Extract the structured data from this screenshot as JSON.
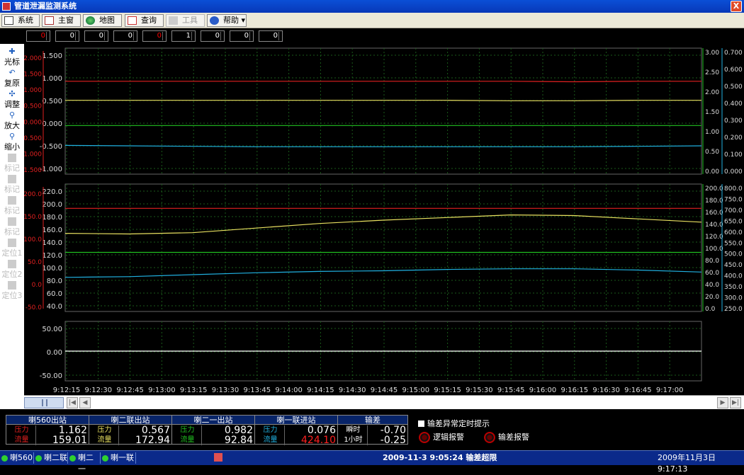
{
  "window": {
    "title": "管道泄漏监测系统",
    "close_label": "X"
  },
  "menu": {
    "system": "系统",
    "main": "主窗",
    "map": "地图",
    "query": "查询",
    "tools": "工具",
    "help": "帮助"
  },
  "spinners": [
    "0",
    "0",
    "0",
    "0",
    "0",
    "1",
    "0",
    "0",
    "0"
  ],
  "left_toolbar": [
    {
      "label": "光标",
      "icon": "plus-icon",
      "enabled": true
    },
    {
      "label": "复原",
      "icon": "undo-icon",
      "enabled": true
    },
    {
      "label": "调整",
      "icon": "adjust-icon",
      "enabled": true
    },
    {
      "label": "放大",
      "icon": "zoom-in-icon",
      "enabled": true
    },
    {
      "label": "缩小",
      "icon": "zoom-out-icon",
      "enabled": true
    },
    {
      "label": "标记",
      "icon": "mark-icon",
      "enabled": false
    },
    {
      "label": "标记",
      "icon": "mark-icon",
      "enabled": false
    },
    {
      "label": "标记",
      "icon": "mark-icon",
      "enabled": false
    },
    {
      "label": "标记",
      "icon": "mark-icon",
      "enabled": false
    },
    {
      "label": "定位1",
      "icon": "locate-icon",
      "enabled": false
    },
    {
      "label": "定位2",
      "icon": "locate-icon",
      "enabled": false
    },
    {
      "label": "定位3",
      "icon": "locate-icon",
      "enabled": false
    }
  ],
  "colors": {
    "red": "#e02020",
    "yellow": "#e8e060",
    "green": "#20c020",
    "cyan": "#20b0e0",
    "white": "#ffffff"
  },
  "chart_data": [
    {
      "type": "line",
      "left_outer_ticks": [
        "2.000",
        "1.500",
        "1.000",
        "0.500",
        "0.000",
        "-0.500",
        "-1.000",
        "-1.500"
      ],
      "left_inner_ticks": [
        "1.500",
        "1.000",
        "0.500",
        "0.000",
        "-0.500",
        "-1.000"
      ],
      "right_inner_ticks": [
        "3.00",
        "2.50",
        "2.00",
        "1.50",
        "1.00",
        "0.50",
        "0.00"
      ],
      "right_outer_ticks": [
        "0.700",
        "0.600",
        "0.500",
        "0.400",
        "0.300",
        "0.200",
        "0.100",
        "0.000"
      ],
      "series": [
        {
          "color": "red",
          "values": [
            1.0,
            1.0,
            1.0,
            1.0,
            1.0,
            1.0,
            1.0,
            1.0,
            0.99,
            1.0,
            1.0
          ]
        },
        {
          "color": "yellow",
          "values": [
            0.57,
            0.57,
            0.57,
            0.57,
            0.57,
            0.57,
            0.57,
            0.56,
            0.56,
            0.57,
            0.57
          ]
        },
        {
          "color": "green",
          "values": [
            0.0,
            0.0,
            0.0,
            0.0,
            0.0,
            0.0,
            0.0,
            0.0,
            0.0,
            0.0,
            0.0
          ]
        },
        {
          "color": "cyan",
          "values": [
            -0.45,
            -0.46,
            -0.47,
            -0.48,
            -0.48,
            -0.48,
            -0.48,
            -0.48,
            -0.48,
            -0.47,
            -0.46
          ]
        }
      ],
      "ylim": [
        -1.1,
        1.75
      ]
    },
    {
      "type": "line",
      "left_outer_ticks": [
        "200.0",
        "150.0",
        "100.0",
        "50.0",
        "0.0",
        "-50.0"
      ],
      "left_inner_ticks": [
        "220.0",
        "200.0",
        "180.0",
        "160.0",
        "140.0",
        "120.0",
        "100.0",
        "80.0",
        "60.0",
        "40.0"
      ],
      "right_inner_ticks": [
        "200.0",
        "180.0",
        "160.0",
        "140.0",
        "120.0",
        "100.0",
        "80.0",
        "60.0",
        "40.0",
        "20.0",
        "0.0"
      ],
      "right_outer_ticks": [
        "800.0",
        "750.0",
        "700.0",
        "650.0",
        "600.0",
        "550.0",
        "500.0",
        "450.0",
        "400.0",
        "350.0",
        "300.0",
        "250.0"
      ],
      "series": [
        {
          "color": "red",
          "values": [
            195,
            195,
            195,
            195,
            195,
            195,
            195,
            195,
            195,
            195,
            195
          ]
        },
        {
          "color": "yellow",
          "values": [
            157,
            156,
            158,
            165,
            172,
            177,
            181,
            185,
            184,
            179,
            174
          ]
        },
        {
          "color": "green",
          "values": [
            128,
            128,
            128,
            128,
            128,
            128,
            128,
            128,
            128,
            128,
            128
          ]
        },
        {
          "color": "cyan",
          "values": [
            90,
            91,
            94,
            97,
            99,
            100,
            102,
            103,
            103,
            101,
            98
          ]
        }
      ],
      "ylim": [
        38,
        232
      ]
    },
    {
      "type": "line",
      "left_inner_ticks": [
        "50.00",
        "0.00",
        "-50.00"
      ],
      "series": [
        {
          "color": "white",
          "values": [
            0,
            0,
            0,
            0,
            0,
            0,
            0,
            0,
            0,
            0,
            0
          ]
        }
      ],
      "ylim": [
        -75,
        75
      ]
    }
  ],
  "time_axis": [
    "9:12:15",
    "9:12:30",
    "9:12:45",
    "9:13:00",
    "9:13:15",
    "9:13:30",
    "9:13:45",
    "9:14:00",
    "9:14:15",
    "9:14:30",
    "9:14:45",
    "9:15:00",
    "9:15:15",
    "9:15:30",
    "9:15:45",
    "9:16:00",
    "9:16:15",
    "9:16:30",
    "9:16:45",
    "9:17:00"
  ],
  "stations": [
    {
      "title": "喇560出站",
      "pressure_label": "压力",
      "pressure": "1.162",
      "flow_label": "流量",
      "flow": "159.01",
      "label_color": "#e02020",
      "flow_color": "#ffffff"
    },
    {
      "title": "喇二联出站",
      "pressure_label": "压力",
      "pressure": "0.567",
      "flow_label": "流量",
      "flow": "172.94",
      "label_color": "#e8e060",
      "flow_color": "#ffffff"
    },
    {
      "title": "喇二一出站",
      "pressure_label": "压力",
      "pressure": "0.982",
      "flow_label": "流量",
      "flow": "92.84",
      "label_color": "#20c020",
      "flow_color": "#ffffff"
    },
    {
      "title": "喇一联进站",
      "pressure_label": "压力",
      "pressure": "0.076",
      "flow_label": "流量",
      "flow": "424.10",
      "label_color": "#20b0e0",
      "flow_color": "#ff2020"
    }
  ],
  "diff": {
    "title": "输差",
    "instant_label": "瞬时",
    "instant": "-0.70",
    "hour_label": "1小时",
    "hour": "-0.25"
  },
  "checkbox": {
    "label": "输差异常定时提示"
  },
  "alarms": {
    "logic": "逻辑报警",
    "diff": "输差报警"
  },
  "status": {
    "cells": [
      "喇560",
      "喇二联",
      "喇二一",
      "喇一联"
    ],
    "message": "2009-11-3 9:05:24 输差超限",
    "datetime": "2009年11月3日  9:17:13"
  }
}
